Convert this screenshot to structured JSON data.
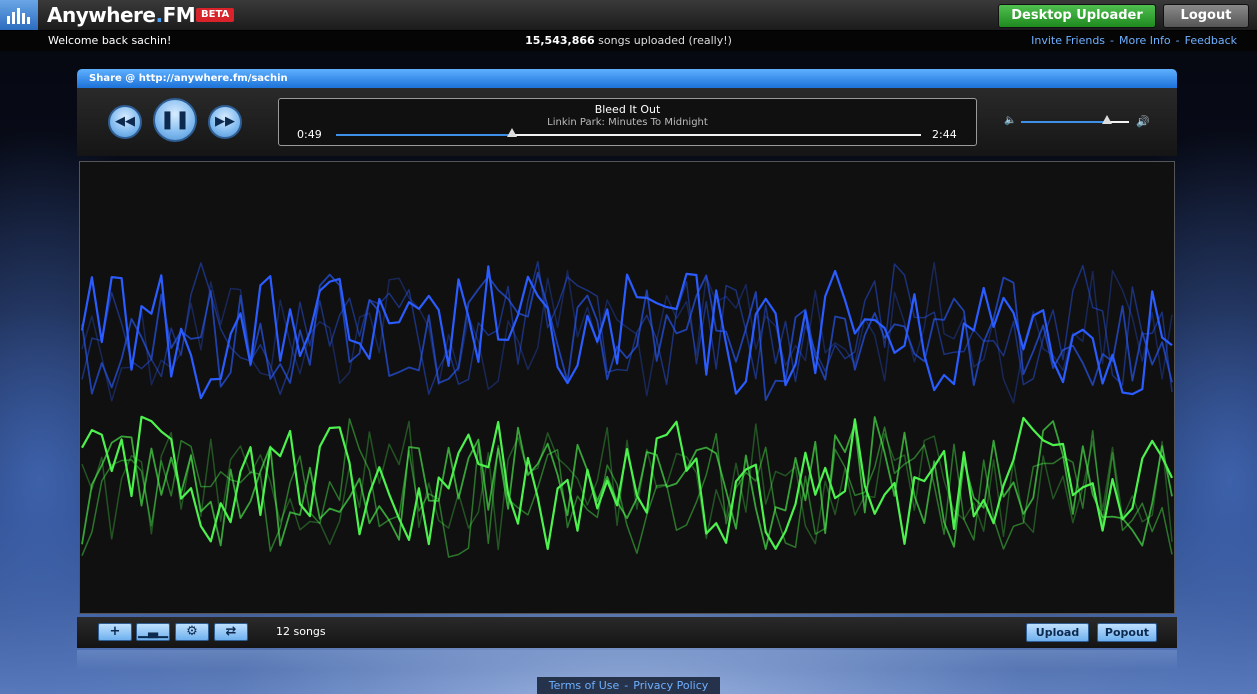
{
  "header": {
    "brand_name": "Anywhere",
    "brand_dot": ".",
    "brand_suffix": "FM",
    "beta_label": "BETA",
    "desktop_uploader_label": "Desktop Uploader",
    "logout_label": "Logout"
  },
  "subbar": {
    "welcome_text": "Welcome back sachin!",
    "songs_count": "15,543,866",
    "songs_suffix": "songs uploaded (really!)",
    "links": {
      "invite": "Invite Friends",
      "more_info": "More Info",
      "feedback": "Feedback",
      "separator": "-"
    }
  },
  "player": {
    "share_label": "Share @ http://anywhere.fm/sachin",
    "now_playing": {
      "title": "Bleed It Out",
      "artist_album": "Linkin Park: Minutes To Midnight",
      "elapsed": "0:49",
      "total": "2:44",
      "progress_fraction": 0.3
    },
    "volume_fraction": 0.8,
    "icons": {
      "rewind": "rewind-icon",
      "pause": "pause-icon",
      "fast_forward": "fast-forward-icon",
      "volume_low": "volume-low-icon",
      "volume_high": "volume-high-icon",
      "add": "add-icon",
      "equalizer": "equalizer-icon",
      "settings": "gears-icon",
      "shuffle": "shuffle-icon"
    },
    "song_count_label": "12 songs",
    "upload_label": "Upload",
    "popout_label": "Popout",
    "colors": {
      "blue_wave": "#2a5cff",
      "green_wave": "#4ef24e",
      "accent": "#3d8fe8"
    }
  },
  "footer": {
    "terms": "Terms of Use",
    "privacy": "Privacy Policy",
    "separator": "-"
  }
}
